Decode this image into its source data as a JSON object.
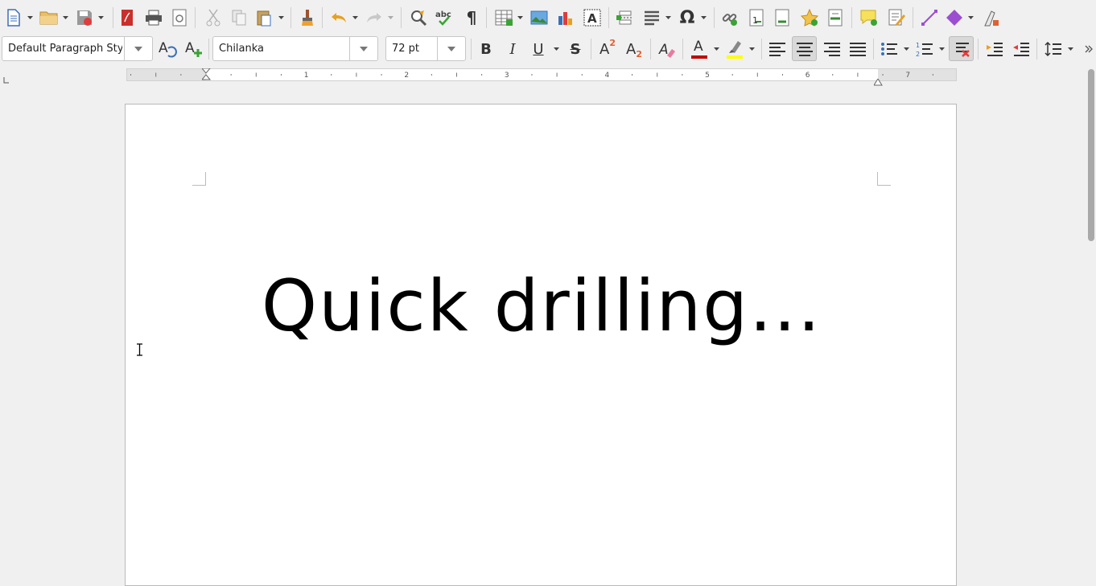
{
  "window": {
    "title": "LibreOffice Writer"
  },
  "toolbar_standard": {
    "items": [
      "new-document",
      "open",
      "save",
      "export-pdf",
      "print",
      "print-preview",
      "cut",
      "copy",
      "paste",
      "clone-formatting",
      "undo",
      "redo",
      "find-replace",
      "spelling",
      "formatting-marks",
      "insert-table",
      "insert-image",
      "insert-chart",
      "insert-text-box",
      "insert-page-break",
      "insert-field",
      "insert-special-character",
      "insert-hyperlink",
      "insert-footnote",
      "insert-endnote",
      "insert-bookmark",
      "insert-cross-reference",
      "insert-comment",
      "track-changes",
      "insert-line",
      "basic-shapes",
      "draw-functions"
    ],
    "special_character_glyph": "Ω",
    "formatting_marks_glyph": "¶"
  },
  "toolbar_formatting": {
    "paragraph_style": "Default Paragraph Styl",
    "font_name": "Chilanka",
    "font_size": "72 pt",
    "bold_glyph": "B",
    "italic_glyph": "I",
    "underline_glyph": "U",
    "strike_glyph": "S",
    "superscript_glyph": "A",
    "superscript_mark": "2",
    "subscript_glyph": "A",
    "subscript_mark": "2",
    "font_color_glyph": "A",
    "font_color": "#c00000",
    "highlight_color": "#ffff00",
    "active_alignment": "center"
  },
  "ruler": {
    "labels": [
      "1",
      "2",
      "3",
      "4",
      "5",
      "6",
      "7"
    ]
  },
  "document": {
    "text": "Quick drilling..."
  }
}
